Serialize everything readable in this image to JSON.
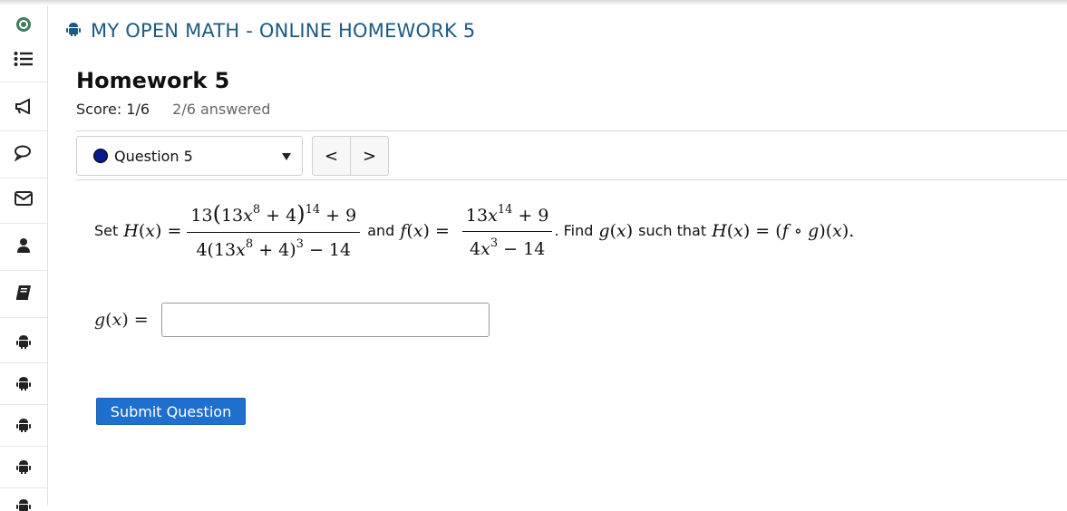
{
  "course": {
    "title": "MY OPEN MATH - ONLINE HOMEWORK 5"
  },
  "assessment": {
    "title": "Homework 5",
    "score": "Score: 1/6",
    "answered": "2/6 answered"
  },
  "question_nav": {
    "selected": "Question 5",
    "prev_label": "<",
    "next_label": ">"
  },
  "problem": {
    "set_label": "Set",
    "and_label": "and",
    "find_label": ". Find",
    "such_that_label": "such that",
    "period": "."
  },
  "answer": {
    "label": "g(x) =",
    "value": ""
  },
  "submit": {
    "label": "Submit Question"
  },
  "sidebar": {
    "items": [
      "logo-icon",
      "menu-list-icon",
      "megaphone-icon",
      "chat-icon",
      "mail-icon",
      "user-icon",
      "book-icon",
      "android-icon",
      "android-icon",
      "android-icon",
      "android-icon",
      "android-icon"
    ]
  },
  "colors": {
    "accent": "#1c5a80",
    "button": "#1f6fce",
    "question_dot": "#0a1a8a"
  }
}
